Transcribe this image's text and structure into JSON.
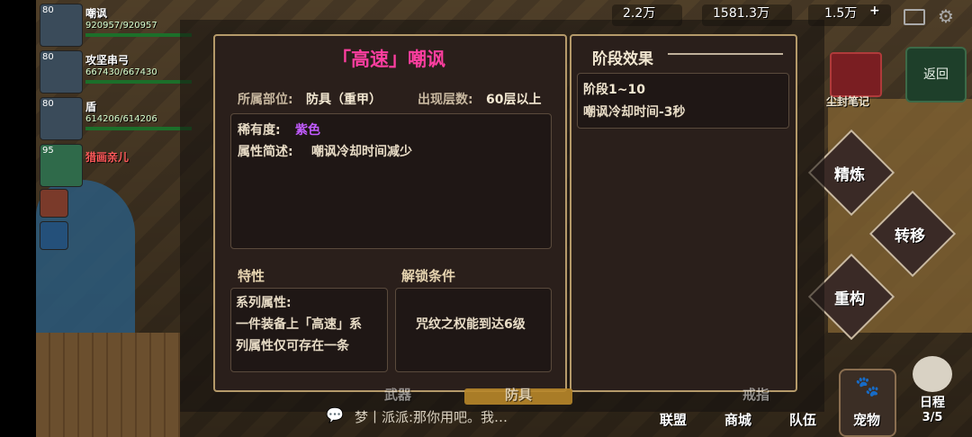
{
  "party": [
    {
      "level": "80",
      "name": "嘲讽",
      "hp": "920957/920957",
      "hp_fraction": 1.0
    },
    {
      "level": "80",
      "name": "攻坚串弓",
      "hp": "667430/667430",
      "hp_fraction": 1.0
    },
    {
      "level": "80",
      "name": "盾",
      "hp": "614206/614206",
      "hp_fraction": 1.0
    },
    {
      "level": "95",
      "name": "猎画亲儿",
      "hp": "",
      "hp_fraction": 0
    }
  ],
  "topbar": {
    "res1": "2.2万",
    "res2": "1581.3万",
    "res3": "1.5万",
    "add": "+"
  },
  "right": {
    "return_label": "返回",
    "dust_label": "尘封笔记",
    "refine": "精炼",
    "transfer": "转移",
    "rebuild": "重构"
  },
  "bottom": {
    "chat": "梦丨派派:那你用吧。我…",
    "tab_left": "武器",
    "tab_mid": "防具",
    "tab_right": "戒指",
    "alliance": "联盟",
    "shop": "商城",
    "team": "队伍",
    "pet": "宠物",
    "schedule": "日程",
    "schedule_count": "3/5"
  },
  "modal": {
    "title": "「高速」嘲讽",
    "slot_label": "所属部位:",
    "slot_value": "防具（重甲）",
    "floor_label": "出现层数:",
    "floor_value": "60层以上",
    "rarity_label": "稀有度:",
    "rarity_value": "紫色",
    "desc_label": "属性简述:",
    "desc_value": "嘲讽冷却时间减少",
    "trait_title": "特性",
    "unlock_title": "解锁条件",
    "trait_lines": [
      "系列属性:",
      "一件装备上「高速」系",
      "列属性仅可存在一条"
    ],
    "unlock_text": "咒纹之权能到达6级",
    "stage_title": "阶段效果",
    "stage_name": "阶段1~10",
    "stage_effect": "嘲讽冷却时间-3秒"
  },
  "colors": {
    "title_pink": "#ff3ea0",
    "rarity_purple": "#c25bff",
    "panel_border": "#b59a6a"
  }
}
